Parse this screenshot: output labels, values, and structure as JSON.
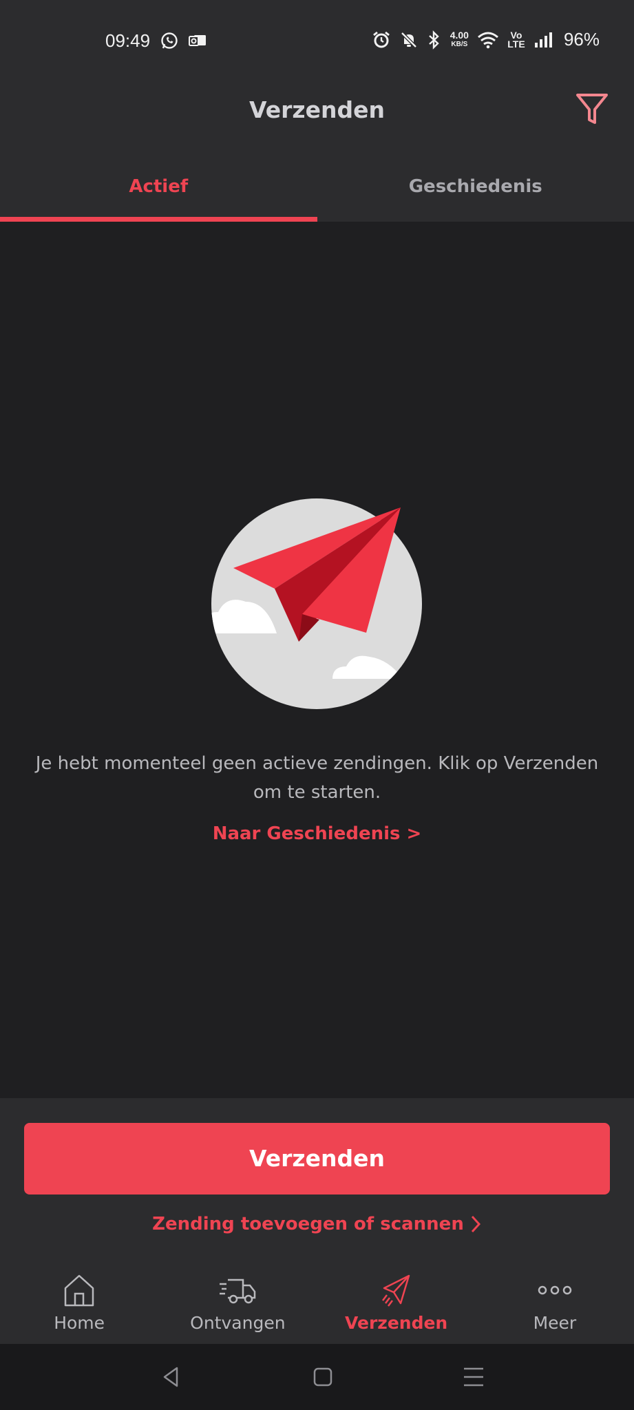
{
  "status": {
    "time": "09:49",
    "net_speed": "4.00",
    "net_unit": "KB/S",
    "network_label": "Vo LTE",
    "battery": "96%"
  },
  "header": {
    "title": "Verzenden"
  },
  "tabs": [
    {
      "label": "Actief",
      "active": true
    },
    {
      "label": "Geschiedenis",
      "active": false
    }
  ],
  "empty_state": {
    "message": "Je hebt momenteel geen actieve zendingen. Klik op Verzenden om te starten.",
    "history_link": "Naar Geschiedenis >"
  },
  "actions": {
    "send_label": "Verzenden",
    "add_link": "Zending toevoegen of scannen"
  },
  "bottom_nav": [
    {
      "label": "Home",
      "icon": "home-icon",
      "active": false
    },
    {
      "label": "Ontvangen",
      "icon": "delivery-truck-icon",
      "active": false
    },
    {
      "label": "Verzenden",
      "icon": "paper-plane-icon",
      "active": true
    },
    {
      "label": "Meer",
      "icon": "more-dots-icon",
      "active": false
    }
  ],
  "colors": {
    "accent": "#ef4452",
    "background": "#1f1f21",
    "surface": "#2c2c2e"
  }
}
